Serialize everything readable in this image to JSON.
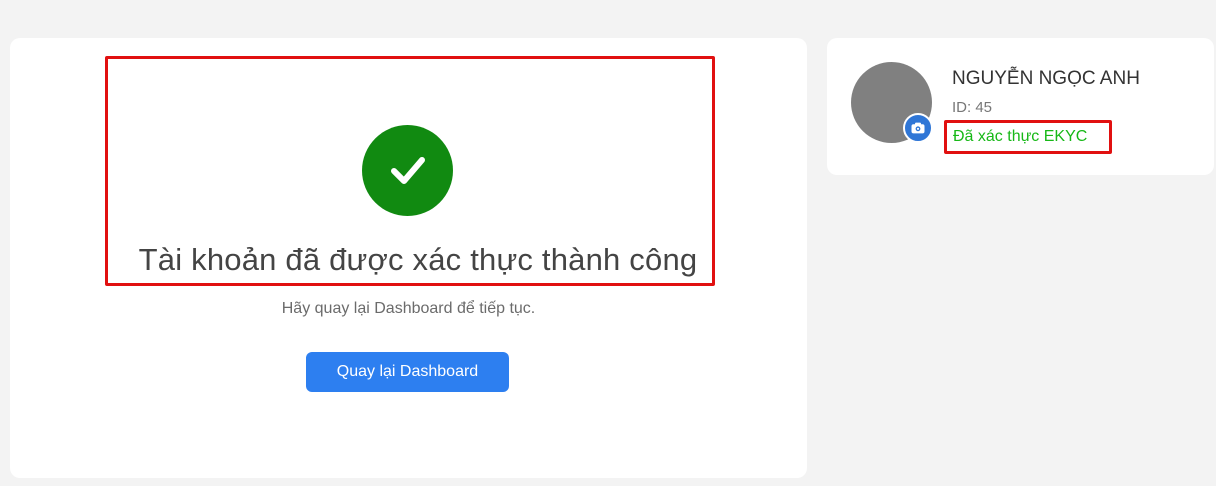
{
  "success": {
    "icon": "check-circle-icon",
    "title": "Tài khoản đã được xác thực thành công",
    "subtitle": "Hãy quay lại Dashboard để tiếp tục.",
    "button_label": "Quay lại Dashboard"
  },
  "profile": {
    "name": "NGUYỄN NGỌC ANH",
    "id_text": "ID: 45",
    "ekyc_status": "Đã xác thực EKYC",
    "avatar_icon": "avatar-placeholder",
    "camera_icon": "camera-icon"
  },
  "colors": {
    "success_green": "#118a11",
    "primary_blue": "#2d7ff0",
    "highlight_red": "#e11010",
    "status_green": "#17b817"
  }
}
